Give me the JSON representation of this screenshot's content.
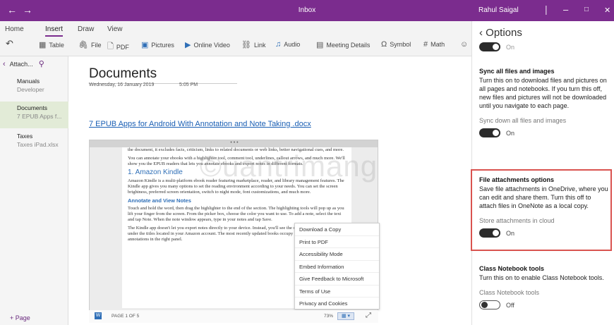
{
  "titlebar": {
    "back": "←",
    "forward": "→",
    "title": "Inbox",
    "user": "Rahul Saigal",
    "sep": "|",
    "minimize": "–",
    "maximize": "□",
    "close": "✕"
  },
  "ribbon": {
    "tabs": [
      "Home",
      "Insert",
      "Draw",
      "View"
    ],
    "buttons": {
      "undo": "↶",
      "table": "Table",
      "file": "File",
      "pdf": "PDF",
      "pictures": "Pictures",
      "online_video": "Online Video",
      "link": "Link",
      "audio": "Audio",
      "meeting": "Meeting Details",
      "symbol": "Symbol",
      "math": "Math"
    }
  },
  "sections": {
    "back_label": "Attach...",
    "items": [
      {
        "title": "Manuals",
        "sub": "Developer"
      },
      {
        "title": "Documents",
        "sub": "7 EPUB Apps f..."
      },
      {
        "title": "Taxes",
        "sub": "Taxes iPad.xlsx"
      }
    ],
    "add_page": "+ Page"
  },
  "note": {
    "title": "Documents",
    "date": "Wednesday, 16 January 2019",
    "time": "5:05 PM",
    "file_link": "7 EPUB Apps for Android With Annotation and Note Taking .docx"
  },
  "viewer": {
    "topbar": "• • •",
    "para1": "the document, it excludes facts, criticism, links to related documents or web links, better navigational cues, and more.",
    "para2": "You can annotate your ebooks with a highlighter tool, comment tool, underlines, callout arrows, and much more. We'll show you the EPUB readers that lets you annotate ebooks and export notes in different formats.",
    "heading1": "1. Amazon Kindle",
    "para3": "Amazon Kindle is a multi-platform ebook reader featuring marketplace, reader, and library management features. The Kindle app gives you many options to set the reading environment according to your needs. You can set the screen brightness, preferred screen orientation, switch to night mode, font customizations, and much more.",
    "heading2": "Annotate and View Notes",
    "para4": "Touch and hold the word, then drag the highlighter to the end of the section. The highlighting tools will pop up as you lift your finger from the screen. From the picker box, choose the color you want to use. To add a note, select the text and tap Note. When the note window appears, type in your notes and tap Save.",
    "para5": "The Kindle app doesn't let you export notes directly to your device. Instead, you'll see the saved highlights organized under the titles located in your Amazon account. The most recently updated books occupy a column on the left and annotations in the right panel.",
    "watermark": "©uantrimang",
    "page_label": "PAGE 1 OF 5",
    "zoom": "73%"
  },
  "context_menu": [
    "Download a Copy",
    "Print to PDF",
    "Accessibility Mode",
    "Embed Information",
    "Give Feedback to Microsoft",
    "Terms of Use",
    "Privacy and Cookies"
  ],
  "options": {
    "header": "Options",
    "top_toggle": "On",
    "sync": {
      "heading": "Sync all files and images",
      "desc": "Turn this on to download files and pictures on all pages and notebooks. If you turn this off, new files and pictures will not be downloaded until you navigate to each page.",
      "sub": "Sync down all files and images",
      "state": "On"
    },
    "attach": {
      "heading": "File attachments options",
      "desc": "Save file attachments in OneDrive, where you can edit and share them. Turn this off to attach files in OneNote as a local copy.",
      "sub": "Store attachments in cloud",
      "state": "On"
    },
    "classnb": {
      "heading": "Class Notebook tools",
      "desc": "Turn this on to enable Class Notebook tools.",
      "sub": "Class Notebook tools",
      "state": "Off"
    }
  },
  "colors": {
    "accent": "#7b2c8e",
    "highlight": "#d9534f",
    "link": "#1a5fb4"
  }
}
